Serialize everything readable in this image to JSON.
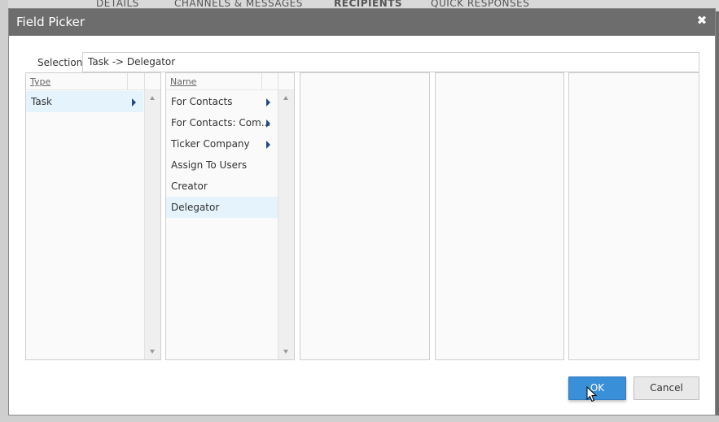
{
  "background": {
    "tabs": [
      "DETAILS",
      "CHANNELS & MESSAGES",
      "RECIPIENTS",
      "QUICK RESPONSES"
    ]
  },
  "dialog": {
    "title": "Field Picker",
    "close_icon": "close-icon",
    "selection_label": "Selection",
    "selection_value": "Task -> Delegator",
    "columns": [
      {
        "header": "Type",
        "items": [
          {
            "label": "Task",
            "has_children": true,
            "selected": true
          }
        ]
      },
      {
        "header": "Name",
        "items": [
          {
            "label": "For Contacts",
            "has_children": true,
            "selected": false
          },
          {
            "label": "For Contacts: Com...",
            "has_children": true,
            "selected": false
          },
          {
            "label": "Ticker Company",
            "has_children": true,
            "selected": false
          },
          {
            "label": "Assign To Users",
            "has_children": false,
            "selected": false
          },
          {
            "label": "Creator",
            "has_children": false,
            "selected": false
          },
          {
            "label": "Delegator",
            "has_children": false,
            "selected": true
          }
        ]
      }
    ],
    "ok_label": "OK",
    "cancel_label": "Cancel",
    "colors": {
      "titlebar": "#6d6d6d",
      "selected_row": "#e5f3fc",
      "ok_button": "#3a8fd9",
      "arrow": "#234a78"
    }
  }
}
